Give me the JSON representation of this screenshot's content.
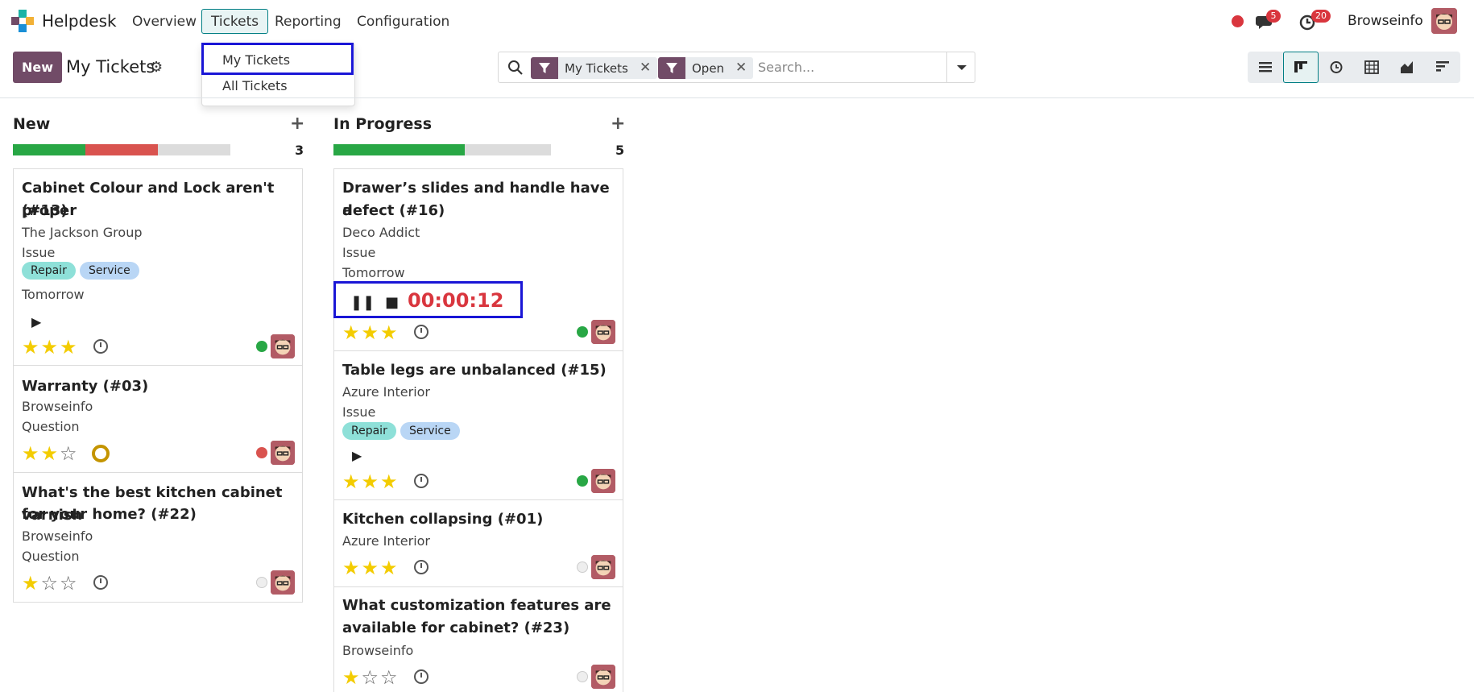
{
  "nav": {
    "app_name": "Helpdesk",
    "menu": [
      "Overview",
      "Tickets",
      "Reporting",
      "Configuration"
    ],
    "messages_count": "5",
    "activities_count": "20",
    "user": "Browseinfo"
  },
  "control": {
    "new_label": "New",
    "breadcrumb": "My Tickets",
    "dropdown": [
      "My Tickets",
      "All Tickets"
    ],
    "facets": [
      "My Tickets",
      "Open"
    ],
    "search_placeholder": "Search..."
  },
  "columns": [
    {
      "title": "New",
      "count": "3",
      "progress": {
        "green": 0.33,
        "red": 0.33
      }
    },
    {
      "title": "In Progress",
      "count": "5",
      "progress": {
        "green": 0.6,
        "red": 0
      }
    }
  ],
  "cards": {
    "c13": {
      "title_l1": "Cabinet Colour and Lock aren't proper",
      "title_l2": "(#13)",
      "customer": "The Jackson Group",
      "type": "Issue",
      "tags": [
        "Repair",
        "Service"
      ],
      "deadline": "Tomorrow",
      "stars": 3,
      "status": "green"
    },
    "c03": {
      "title_l1": "Warranty (#03)",
      "customer": "Browseinfo",
      "type": "Question",
      "stars": 2,
      "status": "red"
    },
    "c22": {
      "title_l1": "What's the best kitchen cabinet varnish",
      "title_l2": "for your home? (#22)",
      "customer": "Browseinfo",
      "type": "Question",
      "stars": 1,
      "status": "grey"
    },
    "c16": {
      "title_l1": "Drawer’s slides and handle have a",
      "title_l2": "defect (#16)",
      "customer": "Deco Addict",
      "type": "Issue",
      "deadline": "Tomorrow",
      "timer": "00:00:12",
      "stars": 3,
      "status": "green"
    },
    "c15": {
      "title_l1": "Table legs are unbalanced (#15)",
      "customer": "Azure Interior",
      "type": "Issue",
      "tags": [
        "Repair",
        "Service"
      ],
      "stars": 3,
      "status": "green"
    },
    "c01": {
      "title_l1": "Kitchen collapsing (#01)",
      "customer": "Azure Interior",
      "stars": 3,
      "status": "grey"
    },
    "c23": {
      "title_l1": "What customization features are",
      "title_l2": "available for cabinet? (#23)",
      "customer": "Browseinfo",
      "stars": 1,
      "status": "grey"
    }
  },
  "colors": {
    "brand": "#714b67",
    "accent": "#017e84",
    "alert": "#d9363e",
    "star": "#f3cc00"
  }
}
